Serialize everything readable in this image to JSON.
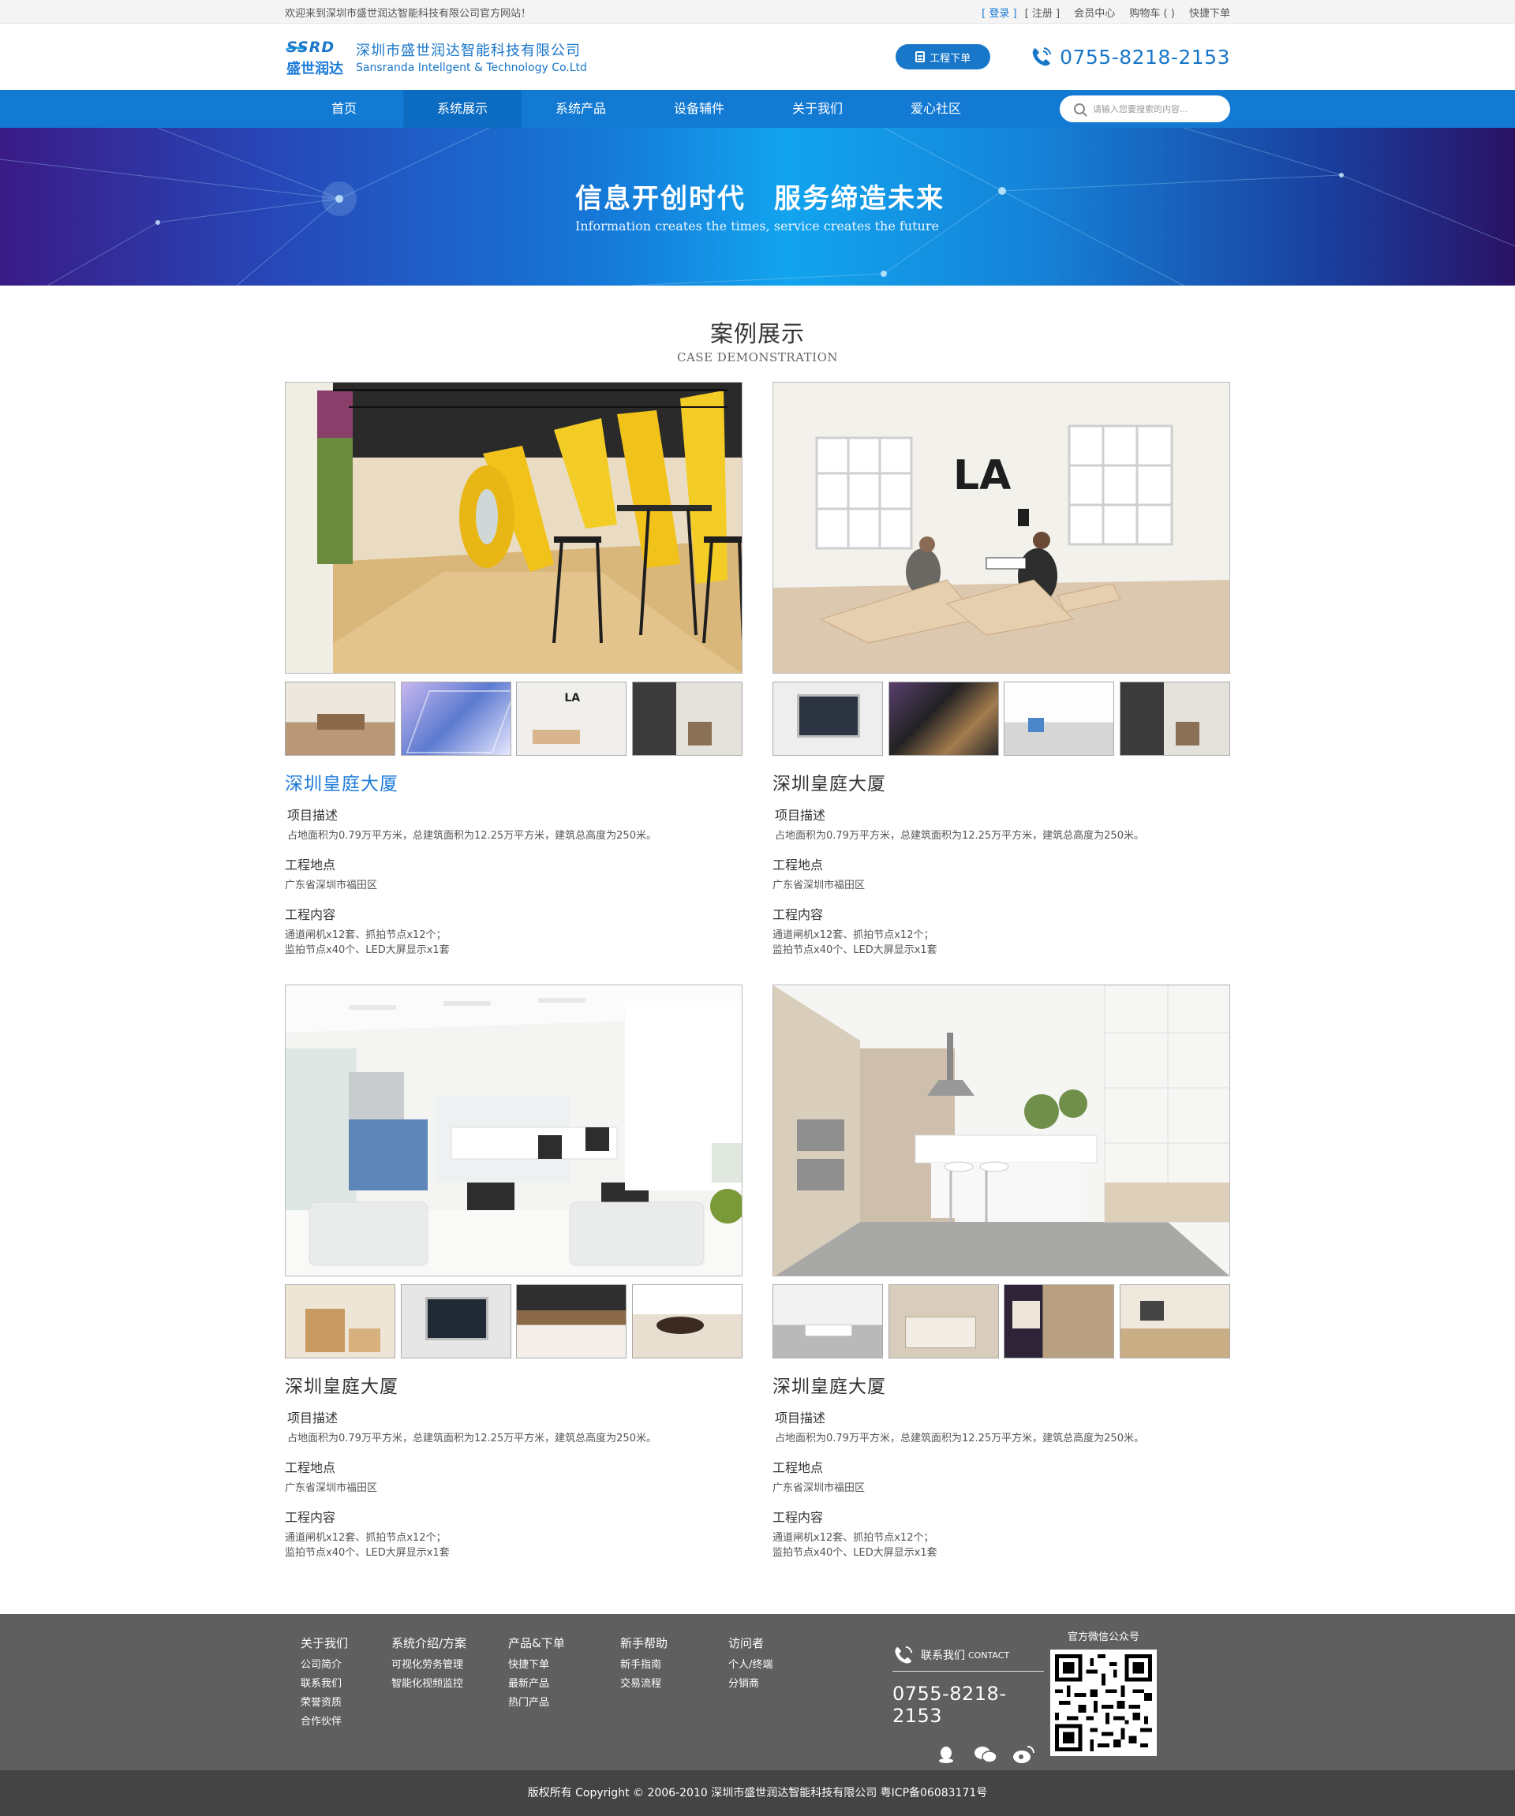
{
  "topbar": {
    "welcome": "欢迎来到深圳市盛世润达智能科技有限公司官方网站！",
    "login": "[ 登录 ]",
    "register": "[ 注册 ]",
    "member": "会员中心",
    "cart": "购物车 (  )",
    "quick_order": "快捷下单"
  },
  "header": {
    "logo_latin": "SSRD",
    "logo_cn": "盛世润达",
    "company_cn": "深圳市盛世润达智能科技有限公司",
    "company_en": "Sansranda Intellgent & Technology Co.Ltd",
    "order_button": "工程下单",
    "phone": "0755-8218-2153"
  },
  "nav": {
    "items": [
      "首页",
      "系统展示",
      "系统产品",
      "设备辅件",
      "关于我们",
      "爱心社区"
    ],
    "search_placeholder": "请输入您要搜索的内容..."
  },
  "banner": {
    "title": "信息开创时代　服务缔造未来",
    "subtitle": "Information creates the times, service creates the future"
  },
  "section": {
    "title": "案例展示",
    "subtitle": "CASE DEMONSTRATION"
  },
  "cases": [
    {
      "title": "深圳皇庭大厦",
      "desc_label": "项目描述",
      "desc": "占地面积为0.79万平方米，总建筑面积为12.25万平方米，建筑总高度为250米。",
      "location_label": "工程地点",
      "location": "广东省深圳市福田区",
      "content_label": "工程内容",
      "content_line1": "通道闸机x12套、抓拍节点x12个；",
      "content_line2": "监拍节点x40个、LED大屏显示x1套"
    },
    {
      "title": "深圳皇庭大厦",
      "desc_label": "项目描述",
      "desc": "占地面积为0.79万平方米，总建筑面积为12.25万平方米，建筑总高度为250米。",
      "location_label": "工程地点",
      "location": "广东省深圳市福田区",
      "content_label": "工程内容",
      "content_line1": "通道闸机x12套、抓拍节点x12个；",
      "content_line2": "监拍节点x40个、LED大屏显示x1套"
    },
    {
      "title": "深圳皇庭大厦",
      "desc_label": "项目描述",
      "desc": "占地面积为0.79万平方米，总建筑面积为12.25万平方米，建筑总高度为250米。",
      "location_label": "工程地点",
      "location": "广东省深圳市福田区",
      "content_label": "工程内容",
      "content_line1": "通道闸机x12套、抓拍节点x12个；",
      "content_line2": "监拍节点x40个、LED大屏显示x1套"
    },
    {
      "title": "深圳皇庭大厦",
      "desc_label": "项目描述",
      "desc": "占地面积为0.79万平方米，总建筑面积为12.25万平方米，建筑总高度为250米。",
      "location_label": "工程地点",
      "location": "广东省深圳市福田区",
      "content_label": "工程内容",
      "content_line1": "通道闸机x12套、抓拍节点x12个；",
      "content_line2": "监拍节点x40个、LED大屏显示x1套"
    }
  ],
  "case1_main_text": "LA",
  "footer": {
    "col1": {
      "title": "关于我们",
      "items": [
        "公司简介",
        "联系我们",
        "荣誉资质",
        "合作伙伴"
      ]
    },
    "col2": {
      "title": "系统介绍/方案",
      "items": [
        "可视化劳务管理",
        "智能化视频监控"
      ]
    },
    "col3": {
      "title": "产品&下单",
      "items": [
        "快捷下单",
        "最新产品",
        "热门产品"
      ]
    },
    "col4": {
      "title": "新手帮助",
      "items": [
        "新手指南",
        "交易流程"
      ]
    },
    "col5": {
      "title": "访问者",
      "items": [
        "个人/终端",
        "分销商"
      ]
    },
    "contact_label": "联系我们",
    "contact_en": "CONTACT",
    "phone": "0755-8218-2153",
    "qr_title": "官方微信公众号",
    "copyright": "版权所有  Copyright © 2006-2010  深圳市盛世润达智能科技有限公司  粤ICP备06083171号"
  },
  "colors": {
    "brand_blue": "#137ad4",
    "active_title": "#1a7ad8",
    "footer_bg": "#5f5f5f",
    "bottom_bg": "#444444"
  }
}
